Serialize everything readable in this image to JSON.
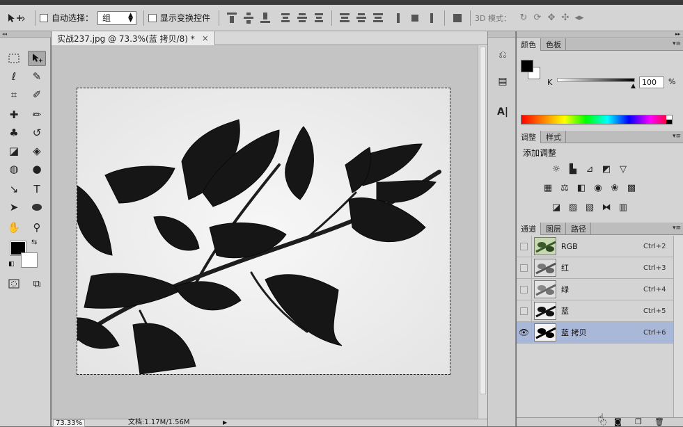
{
  "options_bar": {
    "auto_select_label": "自动选择：",
    "auto_select_value": "组",
    "show_transform_label": "显示变换控件",
    "mode_3d_label": "3D 模式："
  },
  "document": {
    "tab_title": "实战237.jpg @ 73.3%(蓝 拷贝/8) *",
    "close": "×",
    "zoom": "73.33%",
    "doc_info": "文档:1.17M/1.56M"
  },
  "color_panel": {
    "tabs": [
      "颜色",
      "色板"
    ],
    "channel_label": "K",
    "value": "100",
    "unit": "%",
    "foreground": "#000000",
    "background": "#ffffff"
  },
  "adjust_panel": {
    "tabs": [
      "调整",
      "样式"
    ],
    "heading": "添加调整"
  },
  "channels_panel": {
    "tabs": [
      "通道",
      "图层",
      "路径"
    ],
    "rows": [
      {
        "name": "RGB",
        "shortcut": "Ctrl+2",
        "visible": false,
        "selected": false
      },
      {
        "name": "红",
        "shortcut": "Ctrl+3",
        "visible": false,
        "selected": false
      },
      {
        "name": "绿",
        "shortcut": "Ctrl+4",
        "visible": false,
        "selected": false
      },
      {
        "name": "蓝",
        "shortcut": "Ctrl+5",
        "visible": false,
        "selected": false
      },
      {
        "name": "蓝 拷贝",
        "shortcut": "Ctrl+6",
        "visible": true,
        "selected": true
      }
    ]
  },
  "toolbox": {
    "foreground": "#000000",
    "background": "#ffffff"
  }
}
